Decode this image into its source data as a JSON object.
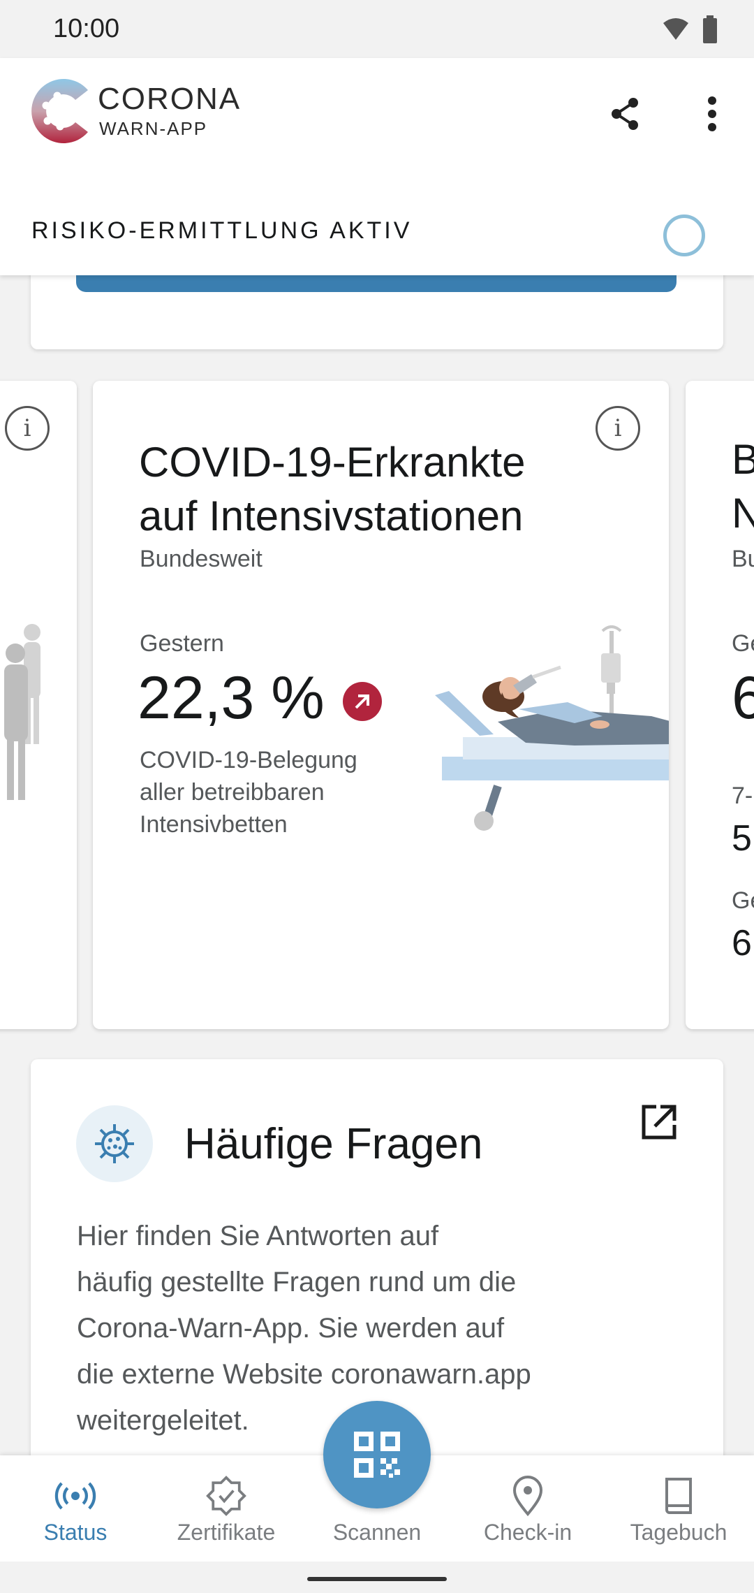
{
  "status_bar": {
    "time": "10:00"
  },
  "header": {
    "brand_title": "CORONA",
    "brand_subtitle": "WARN-APP",
    "risk_status": "RISIKO-ERMITTLUNG AKTIV"
  },
  "stats_carousel": {
    "main_card": {
      "title_line1": "COVID-19-Erkrankte",
      "title_line2": "auf Intensivstationen",
      "subtitle": "Bundesweit",
      "period": "Gestern",
      "value": "22,3 %",
      "trend": "up",
      "desc_line1": "COVID-19-Belegung",
      "desc_line2": "aller betreibbaren",
      "desc_line3": "Intensivbetten"
    },
    "right_card_fragments": {
      "title_1": "B",
      "title_2": "N",
      "subtitle": "Bu",
      "period": "Ge",
      "value": "6",
      "label2": "7-",
      "value2": "5",
      "label3": "Ge",
      "value3": "6"
    }
  },
  "faq": {
    "title": "Häufige Fragen",
    "body_line1": "Hier finden Sie Antworten auf",
    "body_line2": "häufig gestellte Fragen rund um die",
    "body_line3": "Corona-Warn-App. Sie werden auf",
    "body_line4": "die externe Website coronawarn.app",
    "body_line5": "weitergeleitet."
  },
  "bottom_nav": {
    "items": [
      {
        "label": "Status",
        "icon": "broadcast-icon",
        "active": true
      },
      {
        "label": "Zertifikate",
        "icon": "certificate-icon",
        "active": false
      },
      {
        "label": "Scannen",
        "icon": "qr-code-icon",
        "active": false
      },
      {
        "label": "Check-in",
        "icon": "location-pin-icon",
        "active": false
      },
      {
        "label": "Tagebuch",
        "icon": "book-icon",
        "active": false
      }
    ]
  },
  "colors": {
    "accent": "#3a7eb0",
    "trend_up": "#b1243d",
    "fab": "#4f94c4"
  }
}
